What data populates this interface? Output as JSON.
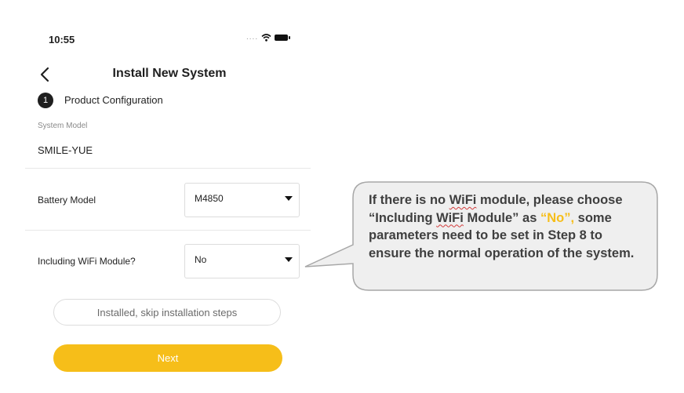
{
  "status_bar": {
    "time": "10:55",
    "signal_dots": "....",
    "icons": [
      "wifi-icon",
      "battery-icon"
    ]
  },
  "header": {
    "title": "Install New System",
    "back_icon": "chevron-left-icon"
  },
  "step": {
    "number": "1",
    "label": "Product Configuration"
  },
  "system": {
    "label": "System Model",
    "value": "SMILE-YUE"
  },
  "battery": {
    "label": "Battery Model",
    "value": "M4850"
  },
  "wifi_module": {
    "label": "Including WiFi Module?",
    "value": "No"
  },
  "buttons": {
    "skip": "Installed, skip installation steps",
    "next": "Next"
  },
  "callout": {
    "part1": "If there is no ",
    "wifi_word_1": "WiFi",
    "part2": " module, please choose “Including ",
    "wifi_word_2": "WiFi",
    "part3": " Module” as ",
    "highlight": "“No”,",
    "part4": " some parameters need to be set in Step 8 to ensure the normal operation of the system."
  },
  "colors": {
    "accent": "#f6be19",
    "callout_fill": "#efefef",
    "callout_border": "#a7a7a7"
  }
}
